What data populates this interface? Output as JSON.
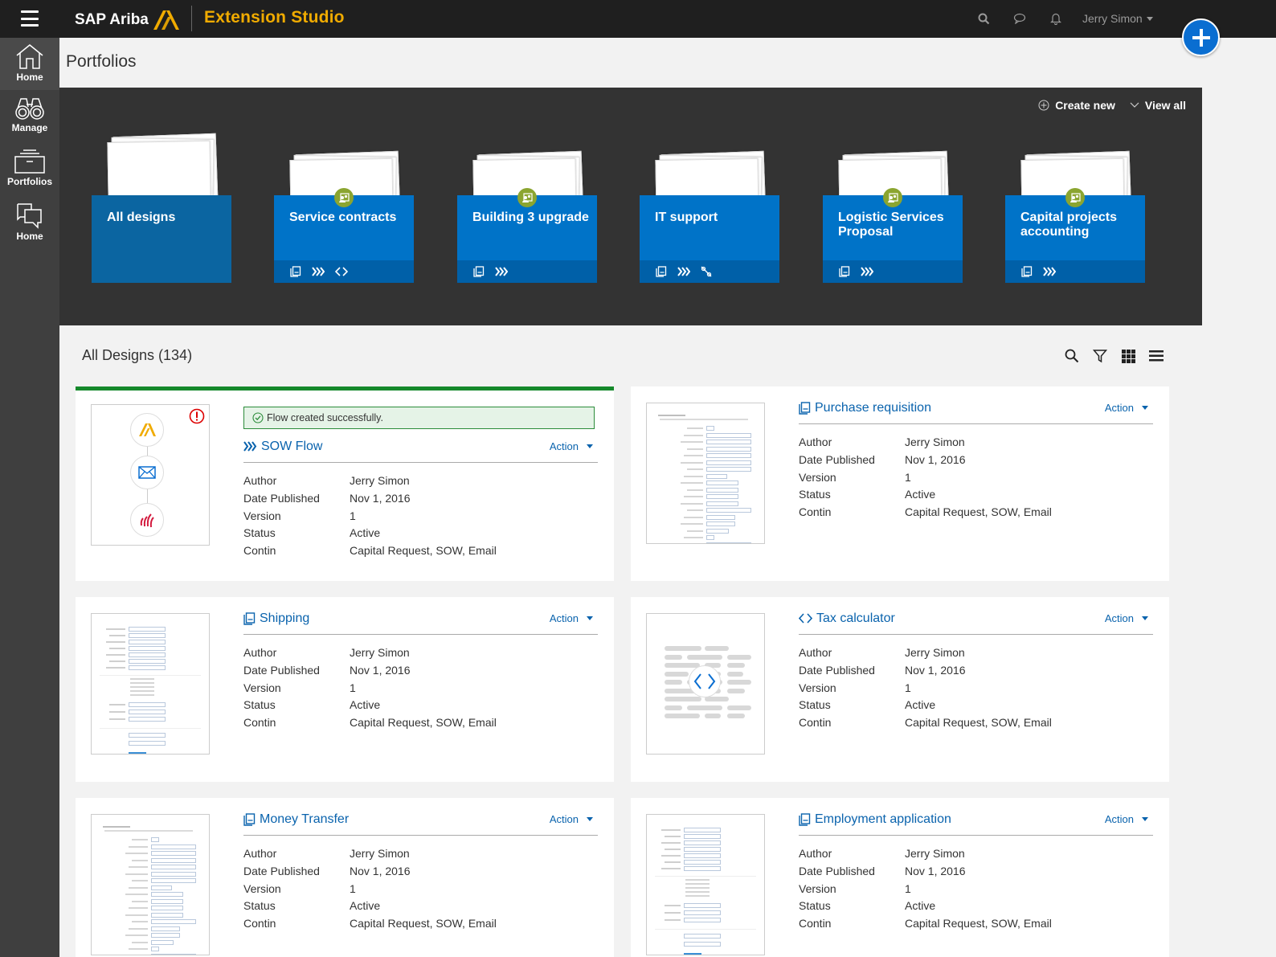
{
  "header": {
    "brand": "SAP Ariba",
    "app_title": "Extension Studio",
    "user_name": "Jerry Simon",
    "icons": [
      "menu-icon",
      "search-icon",
      "chat-icon",
      "bell-icon",
      "add-icon"
    ]
  },
  "sidebar": {
    "items": [
      {
        "label": "Home",
        "icon": "home-icon",
        "active": true
      },
      {
        "label": "Manage",
        "icon": "binoculars-icon"
      },
      {
        "label": "Portfolios",
        "icon": "inbox-tray-icon"
      },
      {
        "label": "Home",
        "icon": "chat-bubbles-icon"
      }
    ]
  },
  "page": {
    "title": "Portfolios"
  },
  "portfolios": {
    "actions": {
      "create_new": "Create new",
      "view_all": "View all"
    },
    "folders": [
      {
        "title": "All designs",
        "shared": false,
        "icons": []
      },
      {
        "title": "Service contracts",
        "shared": true,
        "icons": [
          "form-icon",
          "flow-icon",
          "code-icon"
        ]
      },
      {
        "title": "Building 3 upgrade",
        "shared": true,
        "icons": [
          "form-icon",
          "flow-icon"
        ]
      },
      {
        "title": "IT support",
        "shared": false,
        "icons": [
          "form-icon",
          "flow-icon",
          "connector-icon"
        ]
      },
      {
        "title": "Logistic Services Proposal",
        "shared": true,
        "icons": [
          "form-icon",
          "flow-icon"
        ]
      },
      {
        "title": "Capital projects accounting",
        "shared": true,
        "icons": [
          "form-icon",
          "flow-icon"
        ]
      }
    ]
  },
  "designs": {
    "title": "All Designs (134)",
    "toolbar_icons": [
      "search-icon",
      "filter-icon",
      "grid-view-icon",
      "list-view-icon"
    ],
    "labels": {
      "author": "Author",
      "date": "Date Published",
      "version": "Version",
      "status": "Status",
      "contains": "Contin"
    },
    "action_label": "Action",
    "success_message": "Flow created successfully.",
    "cards": [
      {
        "title": "SOW Flow",
        "type": "flow",
        "author": "Jerry Simon",
        "date": "Nov 1, 2016",
        "version": "1",
        "status": "Active",
        "contains": "Capital Request, SOW, Email"
      },
      {
        "title": "Purchase requisition",
        "type": "form",
        "author": "Jerry Simon",
        "date": "Nov 1, 2016",
        "version": "1",
        "status": "Active",
        "contains": "Capital Request, SOW, Email"
      },
      {
        "title": "Shipping",
        "type": "form",
        "author": "Jerry Simon",
        "date": "Nov 1, 2016",
        "version": "1",
        "status": "Active",
        "contains": "Capital Request, SOW, Email"
      },
      {
        "title": "Tax calculator",
        "type": "code",
        "author": "Jerry Simon",
        "date": "Nov 1, 2016",
        "version": "1",
        "status": "Active",
        "contains": "Capital Request, SOW, Email"
      },
      {
        "title": "Money Transfer",
        "type": "form",
        "author": "Jerry Simon",
        "date": "Nov 1, 2016",
        "version": "1",
        "status": "Active",
        "contains": "Capital Request, SOW, Email"
      },
      {
        "title": "Employment application",
        "type": "form",
        "author": "Jerry Simon",
        "date": "Nov 1, 2016",
        "version": "1",
        "status": "Active",
        "contains": "Capital Request, SOW, Email"
      }
    ]
  },
  "colors": {
    "brand_orange": "#f0ab00",
    "primary_blue": "#0a6ed1",
    "folder_blue": "#0073c8",
    "success_green": "#15892b",
    "shared_badge": "#8ba530"
  }
}
